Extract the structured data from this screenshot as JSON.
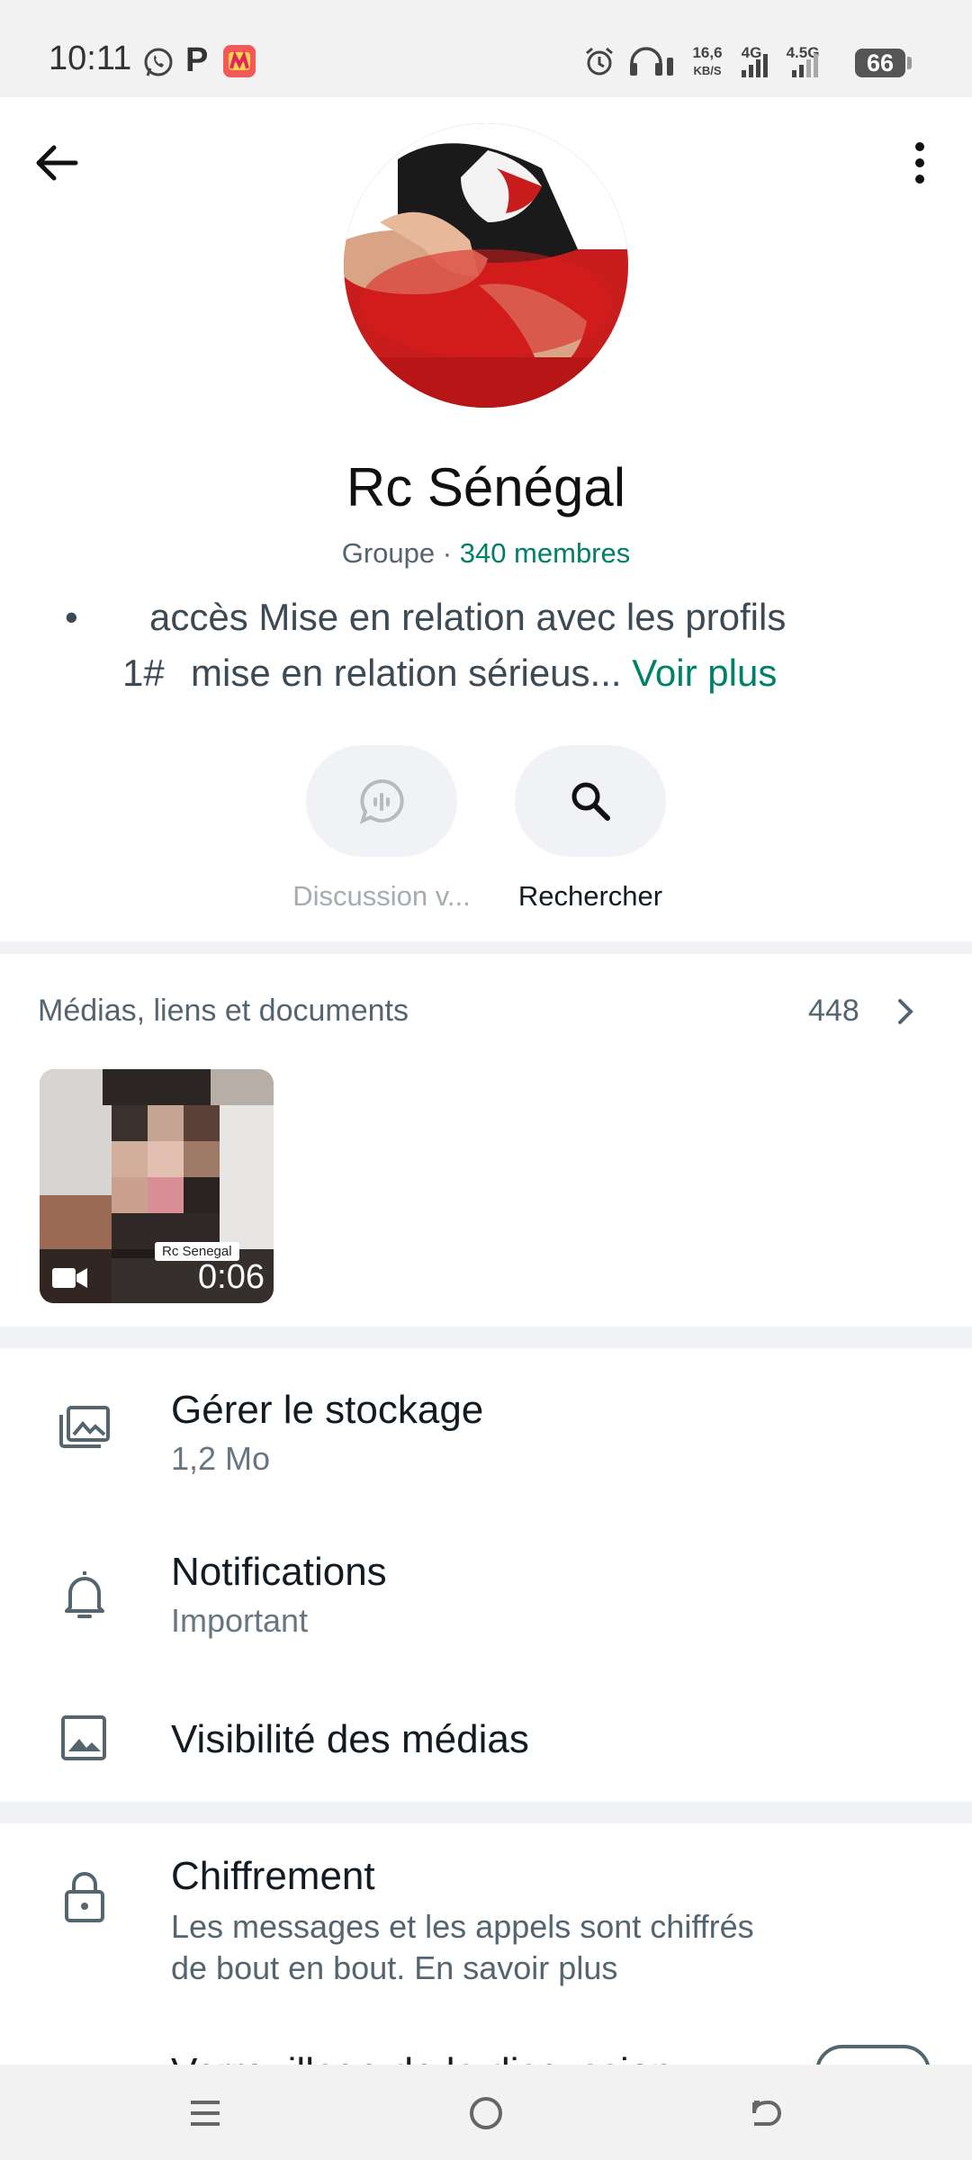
{
  "status_bar": {
    "time": "10:11",
    "net_speed_value": "16,6",
    "net_speed_unit": "KB/S",
    "sim1": "4G",
    "sim2": "4.5G",
    "battery": "66"
  },
  "header": {
    "back_icon": "arrow-left-icon",
    "menu_icon": "more-vertical-icon",
    "group_name": "Rc Sénégal",
    "type": "Groupe",
    "separator": "·",
    "members": "340 membres",
    "bullet": "•",
    "description_line1": "accès Mise en relation avec les profils",
    "description_line2_prefix": "1#",
    "description_line2": "mise en relation sérieus...",
    "see_more": "Voir plus"
  },
  "actions": [
    {
      "label": "Discussion v...",
      "icon": "voice-chat-icon",
      "enabled": false
    },
    {
      "label": "Rechercher",
      "icon": "search-icon",
      "enabled": true
    }
  ],
  "media": {
    "title": "Médias, liens et documents",
    "count": "448",
    "thumb_watermark": "Rc Senegal",
    "thumb_duration": "0:06"
  },
  "settings": [
    {
      "title": "Gérer le stockage",
      "subtitle": "1,2 Mo",
      "icon": "storage-icon"
    },
    {
      "title": "Notifications",
      "subtitle": "Important",
      "icon": "bell-icon"
    },
    {
      "title": "Visibilité des médias",
      "subtitle": "",
      "icon": "image-icon"
    }
  ],
  "encryption": {
    "title": "Chiffrement",
    "line1": "Les messages et les appels sont chiffrés",
    "line2": "de bout en bout. En savoir plus",
    "icon": "lock-icon"
  },
  "partial_row": {
    "title": "Verrouillage de la discussion"
  },
  "colors": {
    "accent": "#008069",
    "background": "#ffffff",
    "separator": "#f0f2f5"
  }
}
